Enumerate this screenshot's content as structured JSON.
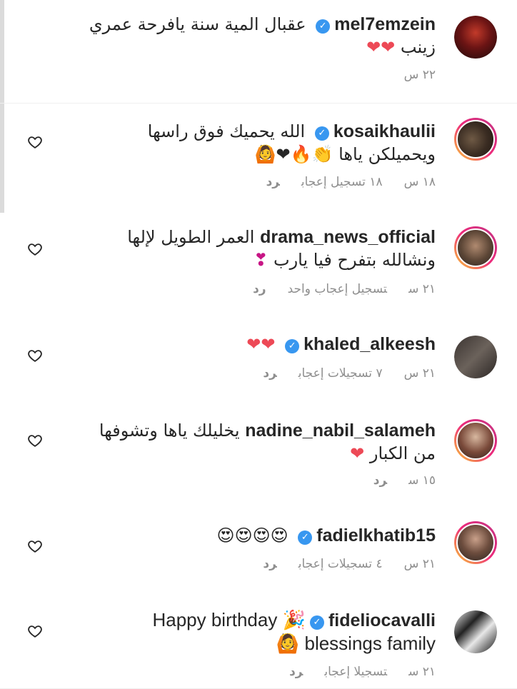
{
  "comments": [
    {
      "username": "mel7emzein",
      "verified": true,
      "text": "عقبال المية سنة يافرحة عمري زينب",
      "emoji": "❤❤",
      "time": "٢٢ س",
      "likes": "",
      "reply": ""
    },
    {
      "username": "kosaikhaulii",
      "verified": true,
      "text": "الله يحميك فوق راسها ويحميلكن ياها",
      "emoji": "👏🔥❤🙆",
      "time": "١٨ س",
      "likes": "١٨ تسجيل إعجاب",
      "reply": "رد"
    },
    {
      "username": "drama_news_official",
      "verified": false,
      "text": "العمر الطويل لإلها ونشالله بتفرح فيا يارب",
      "emoji": "❣",
      "time": "٢١ س",
      "likes": "تسجيل إعجاب واحد",
      "reply": "رد"
    },
    {
      "username": "khaled_alkeesh",
      "verified": true,
      "text": "",
      "emoji": "❤❤",
      "time": "٢١ س",
      "likes": "٧ تسجيلات إعجاب",
      "reply": "رد"
    },
    {
      "username": "nadine_nabil_salameh",
      "verified": false,
      "text": "يخليلك ياها وتشوفها من الكبار",
      "emoji": "❤",
      "time": "١٥ س",
      "likes": "",
      "reply": "رد"
    },
    {
      "username": "fadielkhatib15",
      "verified": true,
      "text": "",
      "emoji": "😍😍😍😍",
      "time": "٢١ س",
      "likes": "٤ تسجيلات إعجاب",
      "reply": "رد"
    },
    {
      "username": "fideliocavalli",
      "verified": true,
      "text_line1": "Happy birthday 🎉",
      "text_line2": "🙆 blessings family",
      "time": "٢١ س",
      "likes": "تسجيلا إعجاب",
      "reply": "رد"
    }
  ],
  "colors": {
    "verified": "#3897f0",
    "heart": "#ed4956",
    "muted": "#8e8e8e"
  },
  "icons": {
    "like": "heart-outline-icon",
    "verified": "verified-badge-icon"
  }
}
